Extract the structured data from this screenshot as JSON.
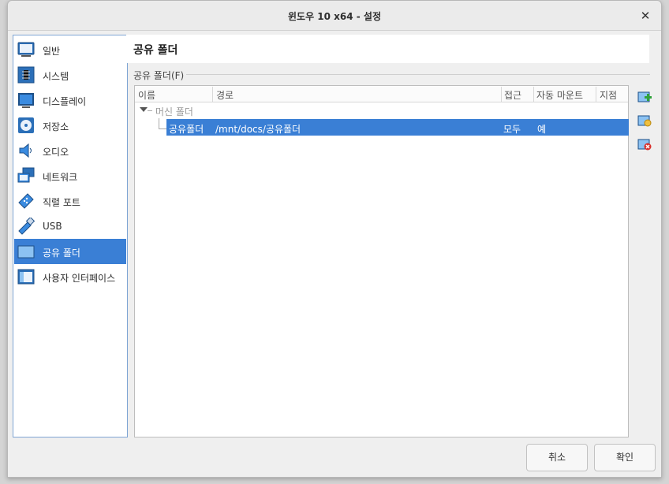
{
  "window": {
    "title": "윈도우 10 x64 - 설정",
    "close_glyph": "✕"
  },
  "sidebar": {
    "items": [
      {
        "label": "일반",
        "icon": "general-icon"
      },
      {
        "label": "시스템",
        "icon": "system-icon"
      },
      {
        "label": "디스플레이",
        "icon": "display-icon"
      },
      {
        "label": "저장소",
        "icon": "storage-icon"
      },
      {
        "label": "오디오",
        "icon": "audio-icon"
      },
      {
        "label": "네트워크",
        "icon": "network-icon"
      },
      {
        "label": "직렬 포트",
        "icon": "serial-port-icon"
      },
      {
        "label": "USB",
        "icon": "usb-icon"
      },
      {
        "label": "공유 폴더",
        "icon": "shared-folder-icon",
        "selected": true
      },
      {
        "label": "사용자 인터페이스",
        "icon": "user-interface-icon"
      }
    ]
  },
  "page": {
    "title": "공유 폴더"
  },
  "group": {
    "label": "공유 폴더(F)"
  },
  "table": {
    "columns": [
      "이름",
      "경로",
      "접근",
      "자동 마운트",
      "지점"
    ],
    "group_row": "머신 폴더",
    "rows": [
      {
        "name": "공유폴더",
        "path": "/mnt/docs/공유폴더",
        "access": "모두",
        "automount": "예",
        "mount_point": ""
      }
    ]
  },
  "tools": [
    "add-shared-folder-icon",
    "edit-shared-folder-icon",
    "remove-shared-folder-icon"
  ],
  "buttons": {
    "cancel": "취소",
    "ok": "확인"
  },
  "colors": {
    "selection": "#3a7fd5",
    "sidebar_border": "#7fa5d4"
  }
}
